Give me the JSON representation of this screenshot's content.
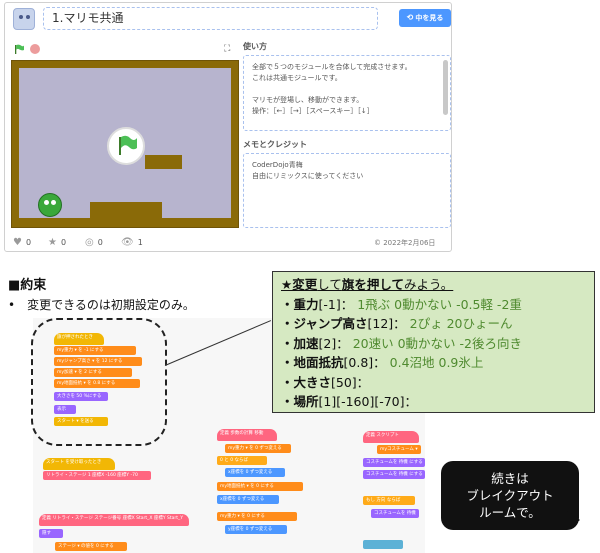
{
  "project": {
    "title": "1.マリモ共通",
    "see_inside_label": "中を見る",
    "instructions_label": "使い方",
    "instructions_text": [
      "全部で５つのモジュールを合体して完成させます。",
      "これは共通モジュールです。",
      "",
      "マリモが登場し、移動ができます。",
      "操作：［←］［→］［スペースキー］［↓］"
    ],
    "notes_label": "メモとクレジット",
    "notes_text": [
      "CoderDojo青梅",
      "自由にリミックスに使ってください"
    ],
    "stats": {
      "loves": "0",
      "favorites": "0",
      "remixes": "0",
      "views": "1"
    },
    "date": "© 2022年2月06日",
    "icons": {
      "love": "heart-icon",
      "favorite": "star-icon",
      "remix": "remix-icon",
      "views": "eye-icon",
      "flag": "green-flag-icon",
      "stop": "stop-icon",
      "fullscreen": "fullscreen-icon"
    },
    "colors": {
      "accent": "#4c97ff",
      "stage_wall": "#8a6a08",
      "stage_bg": "#b7b4ce"
    }
  },
  "slide": {
    "rule_title": "■約束",
    "rule_bullet": "変更できるのは初期設定のみ。",
    "change_box": {
      "heading_prefix": "★変更",
      "heading_mid1": "して",
      "heading_bold2": "旗を押して",
      "heading_suffix": "みよう。",
      "items": [
        {
          "name": "・重力",
          "value": "[-1]：",
          "desc": "1飛ぶ  0動かない  -0.5軽 -2重"
        },
        {
          "name": "・ジャンプ高さ",
          "value": "[12]：",
          "desc": "2ぴょ 20ひょーん"
        },
        {
          "name": "・加速",
          "value": "[2]：",
          "desc": "20速い  0動かない  -2後ろ向き"
        },
        {
          "name": "・地面抵抗",
          "value": "[0.8]：",
          "desc": "0.4沼地  0.9氷上"
        },
        {
          "name": "・大きさ",
          "value": "[50]：",
          "desc": ""
        },
        {
          "name": "・場所",
          "value": "[1][-160][-70]：",
          "desc": ""
        }
      ]
    },
    "callout": [
      "続きは",
      "ブレイクアウト",
      "ルームで。"
    ],
    "code_blocks": {
      "flag_hat": "旗が押されたとき",
      "set_gravity": "my重力 ▾ を -1 にする",
      "set_jump": "myジャンプ高さ ▾ を 12 にする",
      "set_accel": "my加速 ▾ を 2 にする",
      "set_friction": "my地面抵抗 ▾ を 0.8 にする",
      "size": "大きさを 50 %にする",
      "show": "表示",
      "start": "スタート ▾ を送る",
      "recv_start": "スタート を受け取ったとき",
      "move_to": "リトライ・ステージ 1 座標X -160 座標Y -70",
      "define_retry": "定義 リトライ・ステージ ステージ番号 座標X Start_X 座標Y Start_Y",
      "hide": "隠す",
      "set_stage": "ステージ ▾ の値を 0 にする",
      "define_move": "定義 歩数の計算 移動",
      "calc1": "my重力 ▾ を 0 ずつ変える",
      "calc2": "0 と 0 ならば",
      "calc3": "x座標を 0 ずつ変える",
      "calc4": "my地面抵抗 ▾ を 0 にする",
      "calc5": "x座標を 0 ずつ変える",
      "calc6": "my重力 ▾ を 0 にする",
      "calc7": "y座標を 0 ずつ変える",
      "define_costume": "定義 スクリプト",
      "cost1": "myコスチューム ▾",
      "cost2": "コスチュームを 待機 にする",
      "cost3": "コスチュームを 待機 にする",
      "cost4": "もし 方向 ならば",
      "cost5": "コスチュームを 待機"
    }
  }
}
